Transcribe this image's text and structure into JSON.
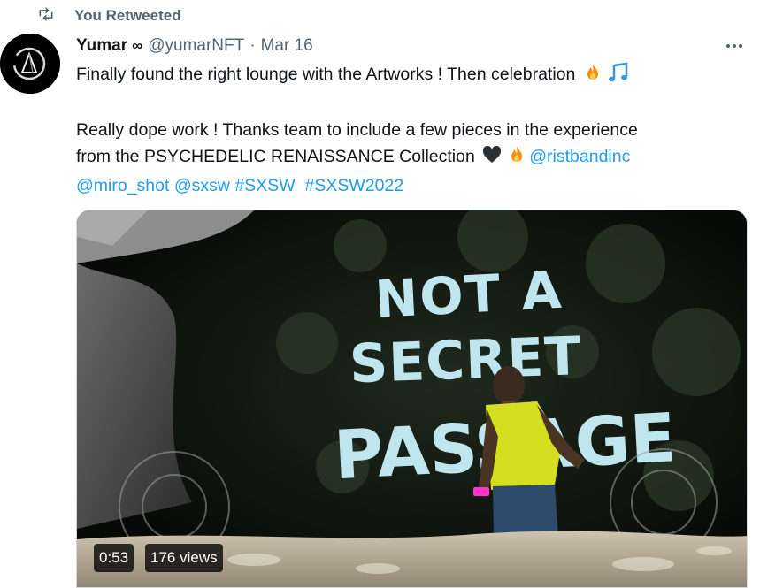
{
  "social_context": {
    "label": "You Retweeted",
    "icon": "retweet-icon"
  },
  "tweet": {
    "author_name": "Yumar",
    "author_suffix": "∞",
    "handle": "@yumarNFT",
    "separator": "·",
    "date": "Mar 16",
    "text": {
      "line1": "Finally found the right lounge with the Artworks ! Then celebration",
      "line2a": "Really dope work ! Thanks team to include a few pieces in the experience",
      "line2b": "from the PSYCHEDELIC RENAISSANCE Collection"
    },
    "mentions": {
      "ristbandinc": "@ristbandinc",
      "miro_shot": "@miro_shot",
      "sxsw": "@sxsw"
    },
    "hashtags": {
      "sxsw": "#SXSW",
      "sxsw2022": "#SXSW2022"
    }
  },
  "media": {
    "duration": "0:53",
    "views": "176 views",
    "scene_text": [
      "NOT A",
      "SECRET",
      "PASSAGE"
    ]
  },
  "colors": {
    "link": "#1d9bf0",
    "secondary_text": "#536471",
    "primary_text": "#0f1419",
    "wall_text": "#bfe6ee",
    "character_shirt": "#d6df1f"
  }
}
